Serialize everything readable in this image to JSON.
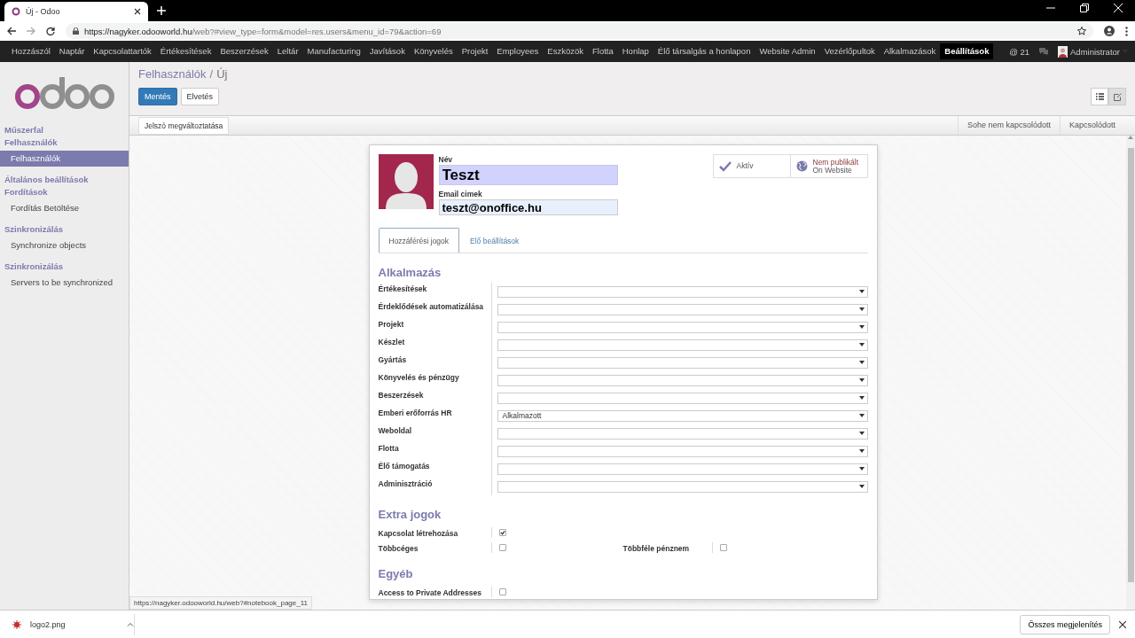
{
  "browser": {
    "tab_title": "Új - Odoo",
    "url_host": "https://nagyker.odooworld.hu",
    "url_rest": "/web?#view_type=form&model=res.users&menu_id=79&action=69"
  },
  "menu": [
    {
      "label": "Hozzászól",
      "selected": false
    },
    {
      "label": "Naptár",
      "selected": false
    },
    {
      "label": "Kapcsolattartók",
      "selected": false
    },
    {
      "label": "Értékesítések",
      "selected": false
    },
    {
      "label": "Beszerzések",
      "selected": false
    },
    {
      "label": "Leltár",
      "selected": false
    },
    {
      "label": "Manufacturing",
      "selected": false
    },
    {
      "label": "Javítások",
      "selected": false
    },
    {
      "label": "Könyvelés",
      "selected": false
    },
    {
      "label": "Projekt",
      "selected": false
    },
    {
      "label": "Employees",
      "selected": false
    },
    {
      "label": "Eszközök",
      "selected": false
    },
    {
      "label": "Flotta",
      "selected": false
    },
    {
      "label": "Honlap",
      "selected": false
    },
    {
      "label": "Élő társalgás a honlapon",
      "selected": false
    },
    {
      "label": "Website Admin",
      "selected": false
    },
    {
      "label": "Vezérlőpultok",
      "selected": false
    },
    {
      "label": "Alkalmazások",
      "selected": false
    },
    {
      "label": "Beállítások",
      "selected": true
    }
  ],
  "menu_right": {
    "mentions": "@ 21",
    "user": "Administrator"
  },
  "sidebar": [
    {
      "kind": "header",
      "label": "Műszerfal"
    },
    {
      "kind": "header",
      "label": "Felhasználók"
    },
    {
      "kind": "item",
      "label": "Felhasználók",
      "selected": true
    },
    {
      "kind": "header",
      "label": "Általános beállítások"
    },
    {
      "kind": "header",
      "label": "Fordítások"
    },
    {
      "kind": "item",
      "label": "Fordítás Betöltése",
      "selected": false
    },
    {
      "kind": "header",
      "label": "Szinkronizálás"
    },
    {
      "kind": "item",
      "label": "Synchronize objects",
      "selected": false
    },
    {
      "kind": "header",
      "label": "Szinkronizálás"
    },
    {
      "kind": "item",
      "label": "Servers to be synchronized",
      "selected": false
    }
  ],
  "breadcrumb": [
    "Felhasználók",
    "Új"
  ],
  "breadcrumb_separator": "/",
  "buttons": {
    "save": "Mentés",
    "discard": "Elvetés"
  },
  "views": [
    {
      "kind": "list",
      "selected": false
    },
    {
      "kind": "form",
      "selected": true
    }
  ],
  "header_button": "Jelszó megváltoztatása",
  "stages": [
    "Sohe nem kapcsolódott",
    "Kapcsolódott"
  ],
  "form": {
    "name_label": "Név",
    "name": "Teszt",
    "email_label": "Email cimek",
    "email": "teszt@onoffice.hu",
    "smart_buttons": [
      {
        "kind": "active",
        "lines": [
          "Aktív"
        ]
      },
      {
        "kind": "website",
        "lines": [
          "Nem publikált",
          "On Website"
        ]
      }
    ],
    "tabs": [
      {
        "label": "Hozzáférési jogok",
        "selected": true
      },
      {
        "label": "Elő beállítások",
        "selected": false
      }
    ],
    "sections": [
      {
        "title": "Alkalmazás",
        "rows": [
          {
            "kind": "select",
            "label": "Értékesítések",
            "value": ""
          },
          {
            "kind": "select",
            "label": "Érdeklődések automatizálása",
            "value": ""
          },
          {
            "kind": "select",
            "label": "Projekt",
            "value": ""
          },
          {
            "kind": "select",
            "label": "Készlet",
            "value": ""
          },
          {
            "kind": "select",
            "label": "Gyártás",
            "value": ""
          },
          {
            "kind": "select",
            "label": "Könyvelés és pénzügy",
            "value": ""
          },
          {
            "kind": "select",
            "label": "Beszerzések",
            "value": ""
          },
          {
            "kind": "select",
            "label": "Emberi erőforrás HR",
            "value": "Alkalmazott"
          },
          {
            "kind": "select",
            "label": "Weboldal",
            "value": ""
          },
          {
            "kind": "select",
            "label": "Flotta",
            "value": ""
          },
          {
            "kind": "select",
            "label": "Élő támogatás",
            "value": ""
          },
          {
            "kind": "select",
            "label": "Adminisztráció",
            "value": ""
          }
        ]
      },
      {
        "title": "Extra jogok",
        "rows": [
          {
            "kind": "check",
            "label": "Kapcsolat létrehozása",
            "checked": true
          },
          {
            "kind": "check",
            "label": "Többcéges",
            "checked": false,
            "second": {
              "label": "Többféle pénznem",
              "checked": false
            }
          }
        ]
      },
      {
        "title": "Egyéb",
        "rows": [
          {
            "kind": "check",
            "label": "Access to Private Addresses",
            "checked": false
          }
        ]
      }
    ]
  },
  "status_url": "https://nagyker.odooworld.hu/web?#notebook_page_11",
  "downloads": {
    "file": "logo2.png",
    "show_all": "Összes megjelenítés"
  }
}
